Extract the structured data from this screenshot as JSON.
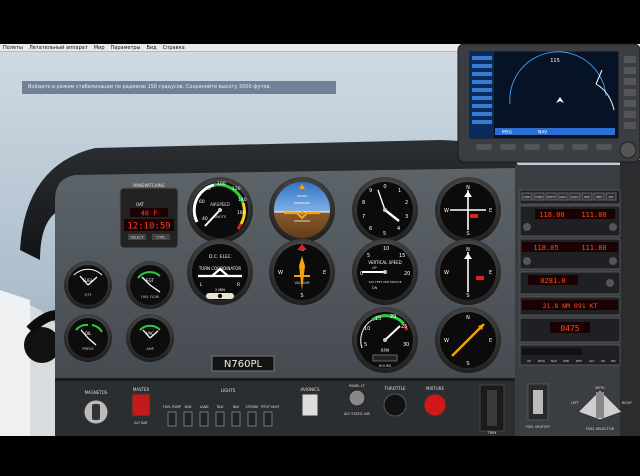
{
  "menu": [
    "Полеты",
    "Летательный аппарат",
    "Мир",
    "Параметры",
    "Вид",
    "Справка"
  ],
  "atc_message": "Войдите в режим стабилизации по радиалю 150 градусов. Сохраняйте высоту 3000 футов.",
  "clock": {
    "caption": "MINISWITCHING",
    "oat_label": "OAT",
    "oat_value": "48 F",
    "volts": "VOLTS",
    "time": "12:10:59",
    "buttons": [
      "SELECT",
      "CTRL"
    ]
  },
  "airspeed": {
    "caption": "AIRSPEED",
    "unit": "KNOTS",
    "ticks": [
      "40",
      "60",
      "80",
      "100",
      "120",
      "140",
      "160",
      "180",
      "200"
    ]
  },
  "attitude": {
    "caption": "ATTITUDE"
  },
  "altimeter": {
    "caption": "ALT",
    "ticks": [
      "0",
      "1",
      "2",
      "3",
      "4",
      "5",
      "6",
      "7",
      "8",
      "9"
    ]
  },
  "vor1": {
    "ticks": [
      "N",
      "3",
      "6",
      "E",
      "12",
      "15",
      "S",
      "21",
      "24",
      "W",
      "30",
      "33"
    ]
  },
  "turn": {
    "caption": "TURN COORDINATOR",
    "sub": "D.C. ELEC",
    "labels": [
      "L",
      "R",
      "2 MIN",
      "NO PITCH INFORMATION"
    ]
  },
  "heading": {
    "ticks": [
      "N",
      "3",
      "6",
      "E",
      "12",
      "15",
      "S",
      "21",
      "24",
      "W",
      "30",
      "33"
    ],
    "caption": "VACUUM"
  },
  "vsi": {
    "caption": "VERTICAL SPEED",
    "unit": "100 FEET PER MINUTE",
    "ticks": [
      "0",
      "5",
      "10",
      "15",
      "20"
    ],
    "sub": "UP",
    "sub2": "DN"
  },
  "vor2": {
    "ticks": [
      "N",
      "3",
      "6",
      "E",
      "12",
      "15",
      "S",
      "21",
      "24",
      "W",
      "30",
      "33"
    ]
  },
  "engine_small": [
    {
      "label": "FUEL",
      "sub": "QTY"
    },
    {
      "label": "EGT",
      "sub": "FUEL FLOW"
    },
    {
      "label": "OIL",
      "sub": "PRESS"
    },
    {
      "label": "VAC",
      "sub": "AMP"
    }
  ],
  "tach": {
    "caption": "RPM",
    "sub": "HOURS",
    "ticks": [
      "5",
      "10",
      "15",
      "20",
      "25",
      "30",
      "35"
    ]
  },
  "adf": {
    "ticks": [
      "N",
      "3",
      "6",
      "E",
      "12",
      "15",
      "S",
      "21",
      "24",
      "W",
      "30",
      "33"
    ]
  },
  "tail_number": "N760PL",
  "radio_stack": {
    "audio": [
      "COM1",
      "COM2",
      "BOTH",
      "NAV1",
      "NAV2",
      "MKR",
      "DME",
      "ADF"
    ],
    "com1_active": "118.00",
    "com1_standby": "111.80",
    "com2_active": "118.05",
    "com2_standby": "124.85",
    "nav2_active": "111.80",
    "nav2_standby": "111.80",
    "adf_freq": "0281.0",
    "dme": "21.8 NM  091 KT",
    "xpdr": "0475",
    "ap_labels": [
      "AP",
      "HDG",
      "NAV",
      "APR",
      "REV",
      "ALT",
      "UP",
      "DN"
    ]
  },
  "gps": {
    "header": "",
    "labels": [
      "MSG",
      "NAV",
      "OBS",
      "ALT",
      "ENT",
      "CLR"
    ],
    "distance": "115"
  },
  "switches": {
    "magnetos": "MAGNETOS",
    "master": "MASTER",
    "alt_bat": "ALT BAT",
    "fuel_pump": "FUEL PUMP",
    "bcn": "BCN",
    "land": "LAND",
    "taxi": "TAXI",
    "nav": "NAV",
    "strobe": "STROBE",
    "pitot_heat": "PITOT HEAT",
    "avionics": "AVIONICS",
    "lights": "LIGHTS",
    "throttle": "THROTTLE",
    "mixture": "MIXTURE",
    "panel_lt": "PANEL LT",
    "alt_static": "ALT STATIC AIR",
    "fuel_shutoff": "FUEL SHUTOFF",
    "fuel_selector": "FUEL SELECTOR",
    "both": "BOTH",
    "left": "LEFT",
    "right": "RIGHT",
    "trim": "TRIM"
  }
}
